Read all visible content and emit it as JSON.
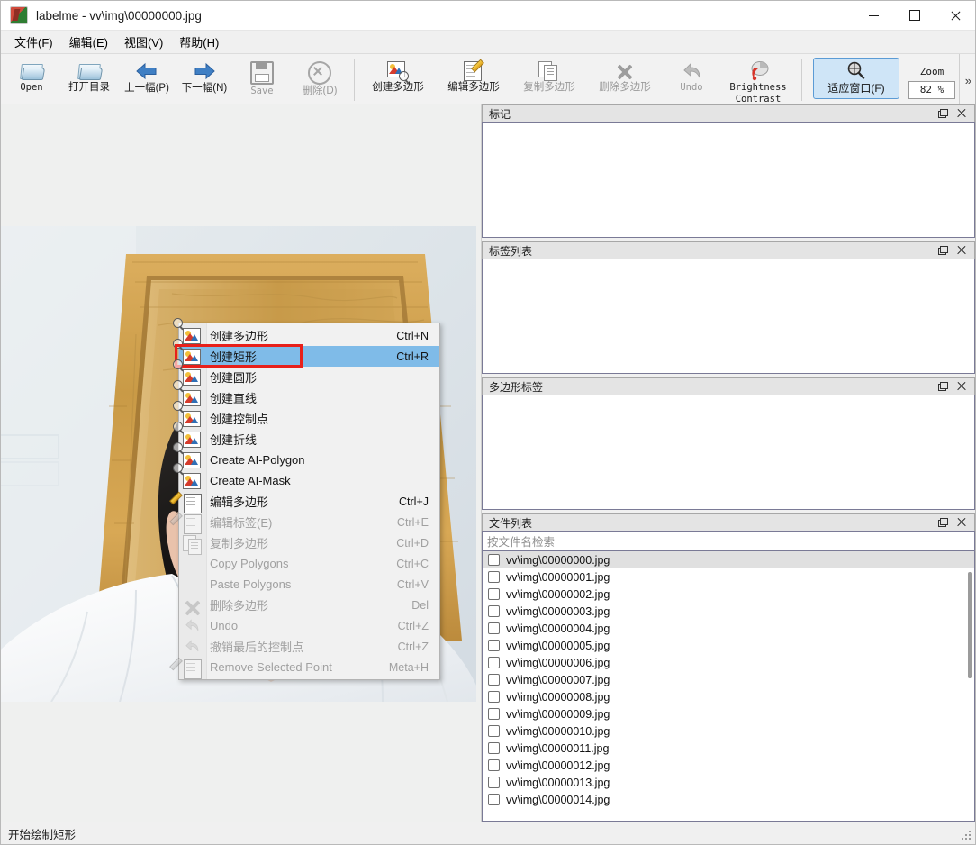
{
  "window": {
    "title": "labelme - vv\\img\\00000000.jpg",
    "app_icon": "labelme-logo-icon",
    "minimize": "minimize-icon",
    "maximize": "maximize-icon",
    "close": "close-icon"
  },
  "menubar": [
    {
      "label": "文件(F)"
    },
    {
      "label": "编辑(E)"
    },
    {
      "label": "视图(V)"
    },
    {
      "label": "帮助(H)"
    }
  ],
  "toolbar": {
    "items": [
      {
        "label": "Open",
        "icon": "open-folder-icon",
        "enabled": true,
        "mono": true
      },
      {
        "label": "打开目录",
        "icon": "open-dir-folder-icon",
        "enabled": true,
        "mono": false
      },
      {
        "label": "上一幅(P)",
        "icon": "arrow-left-icon",
        "enabled": true,
        "mono": false
      },
      {
        "label": "下一幅(N)",
        "icon": "arrow-right-icon",
        "enabled": true,
        "mono": false
      },
      {
        "label": "Save",
        "icon": "save-floppy-icon",
        "enabled": false,
        "mono": true
      },
      {
        "label": "删除(D)",
        "icon": "delete-circle-icon",
        "enabled": false,
        "mono": false
      },
      {
        "label": "创建多边形",
        "icon": "create-polygon-icon",
        "enabled": true,
        "mono": false
      },
      {
        "label": "编辑多边形",
        "icon": "edit-polygon-icon",
        "enabled": true,
        "mono": false
      },
      {
        "label": "复制多边形",
        "icon": "copy-polygon-icon",
        "enabled": false,
        "mono": false
      },
      {
        "label": "删除多边形",
        "icon": "delete-polygon-icon",
        "enabled": false,
        "mono": false
      },
      {
        "label": "Undo",
        "icon": "undo-arrow-icon",
        "enabled": false,
        "mono": true
      },
      {
        "label": "Brightness\nContrast",
        "label_line1": "Brightness",
        "label_line2": "Contrast",
        "icon": "brightness-contrast-icon",
        "enabled": true,
        "mono": true
      }
    ],
    "fit_window": {
      "label": "适应窗口(F)",
      "icon": "zoom-fit-icon",
      "active": true
    },
    "zoom": {
      "label": "Zoom",
      "value": "82 %"
    },
    "overflow": "»"
  },
  "context_menu": {
    "highlighted_index": 1,
    "items": [
      {
        "label": "创建多边形",
        "shortcut": "Ctrl+N",
        "icon": "create-polygon-icon",
        "enabled": true
      },
      {
        "label": "创建矩形",
        "shortcut": "Ctrl+R",
        "icon": "create-rectangle-icon",
        "enabled": true
      },
      {
        "label": "创建圆形",
        "shortcut": "",
        "icon": "create-circle-icon",
        "enabled": true
      },
      {
        "label": "创建直线",
        "shortcut": "",
        "icon": "create-line-icon",
        "enabled": true
      },
      {
        "label": "创建控制点",
        "shortcut": "",
        "icon": "create-point-icon",
        "enabled": true
      },
      {
        "label": "创建折线",
        "shortcut": "",
        "icon": "create-linestrip-icon",
        "enabled": true
      },
      {
        "label": "Create AI-Polygon",
        "shortcut": "",
        "icon": "create-ai-polygon-icon",
        "enabled": true
      },
      {
        "label": "Create AI-Mask",
        "shortcut": "",
        "icon": "create-ai-mask-icon",
        "enabled": true
      },
      {
        "label": "编辑多边形",
        "shortcut": "Ctrl+J",
        "icon": "edit-polygon-icon",
        "enabled": true
      },
      {
        "label": "编辑标签(E)",
        "shortcut": "Ctrl+E",
        "icon": "edit-label-icon",
        "enabled": false
      },
      {
        "label": "复制多边形",
        "shortcut": "Ctrl+D",
        "icon": "duplicate-polygon-icon",
        "enabled": false
      },
      {
        "label": "Copy Polygons",
        "shortcut": "Ctrl+C",
        "icon": "",
        "enabled": false
      },
      {
        "label": "Paste Polygons",
        "shortcut": "Ctrl+V",
        "icon": "",
        "enabled": false
      },
      {
        "label": "删除多边形",
        "shortcut": "Del",
        "icon": "delete-polygon-icon",
        "enabled": false
      },
      {
        "label": "Undo",
        "shortcut": "Ctrl+Z",
        "icon": "undo-arrow-icon",
        "enabled": false
      },
      {
        "label": "撤销最后的控制点",
        "shortcut": "Ctrl+Z",
        "icon": "undo-point-icon",
        "enabled": false
      },
      {
        "label": "Remove Selected Point",
        "shortcut": "Meta+H",
        "icon": "remove-point-icon",
        "enabled": false
      }
    ]
  },
  "panels": {
    "flags": {
      "title": "标记",
      "float_icon": "float-icon",
      "close_icon": "close-icon"
    },
    "label_list": {
      "title": "标签列表",
      "float_icon": "float-icon",
      "close_icon": "close-icon"
    },
    "polygon_labels": {
      "title": "多边形标签",
      "float_icon": "float-icon",
      "close_icon": "close-icon"
    },
    "file_list": {
      "title": "文件列表",
      "float_icon": "float-icon",
      "close_icon": "close-icon",
      "search_placeholder": "按文件名检索",
      "search_value": "",
      "selected_index": 0,
      "files": [
        "vv\\img\\00000000.jpg",
        "vv\\img\\00000001.jpg",
        "vv\\img\\00000002.jpg",
        "vv\\img\\00000003.jpg",
        "vv\\img\\00000004.jpg",
        "vv\\img\\00000005.jpg",
        "vv\\img\\00000006.jpg",
        "vv\\img\\00000007.jpg",
        "vv\\img\\00000008.jpg",
        "vv\\img\\00000009.jpg",
        "vv\\img\\00000010.jpg",
        "vv\\img\\00000011.jpg",
        "vv\\img\\00000012.jpg",
        "vv\\img\\00000013.jpg",
        "vv\\img\\00000014.jpg"
      ]
    }
  },
  "statusbar": {
    "message": "开始绘制矩形"
  },
  "colors": {
    "accent": "#5b9bd5",
    "highlight": "#7fbbe8",
    "marker_red": "#e8201a",
    "canvas_bg": "#eff0ef"
  }
}
